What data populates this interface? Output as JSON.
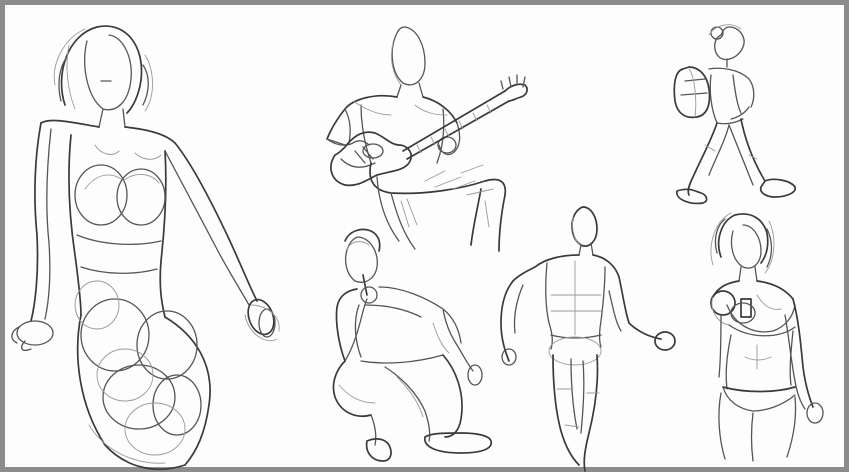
{
  "sheet": {
    "subjects": [
      "seated-woman",
      "guitarist",
      "hiker-with-backpack",
      "crouching-man-with-microphone",
      "walking-figure",
      "woman-holding-phone"
    ],
    "colors": {
      "frame": "#8c8c8c",
      "paper": "#fdfdfd",
      "stroke": "#555555",
      "light_stroke": "#9a9a9a"
    }
  }
}
